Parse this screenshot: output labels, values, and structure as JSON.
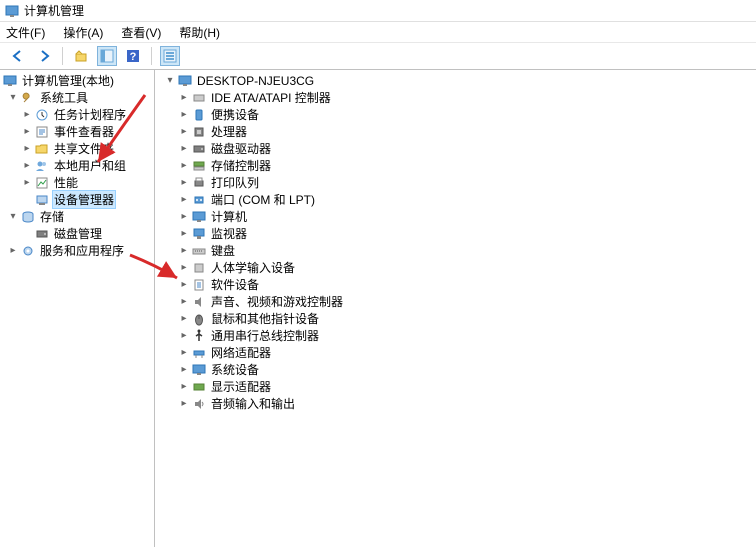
{
  "window": {
    "title": "计算机管理"
  },
  "menubar": {
    "file": "文件(F)",
    "action": "操作(A)",
    "view": "查看(V)",
    "help": "帮助(H)"
  },
  "left_tree": {
    "root": "计算机管理(本地)",
    "system_tools": {
      "label": "系统工具",
      "task_scheduler": "任务计划程序",
      "event_viewer": "事件查看器",
      "shared_folders": "共享文件夹",
      "local_users": "本地用户和组",
      "performance": "性能",
      "device_manager": "设备管理器"
    },
    "storage": {
      "label": "存储",
      "disk_management": "磁盘管理"
    },
    "services_apps": "服务和应用程序"
  },
  "right_tree": {
    "computer": "DESKTOP-NJEU3CG",
    "items": {
      "ide": "IDE ATA/ATAPI 控制器",
      "portable": "便携设备",
      "processors": "处理器",
      "disk_drives": "磁盘驱动器",
      "storage_controllers": "存储控制器",
      "print_queues": "打印队列",
      "ports": "端口 (COM 和 LPT)",
      "computers": "计算机",
      "monitors": "监视器",
      "keyboards": "键盘",
      "hid": "人体学输入设备",
      "software": "软件设备",
      "audio": "声音、视频和游戏控制器",
      "mice": "鼠标和其他指针设备",
      "usb": "通用串行总线控制器",
      "network": "网络适配器",
      "system": "系统设备",
      "display": "显示适配器",
      "audio_io": "音频输入和输出"
    }
  }
}
